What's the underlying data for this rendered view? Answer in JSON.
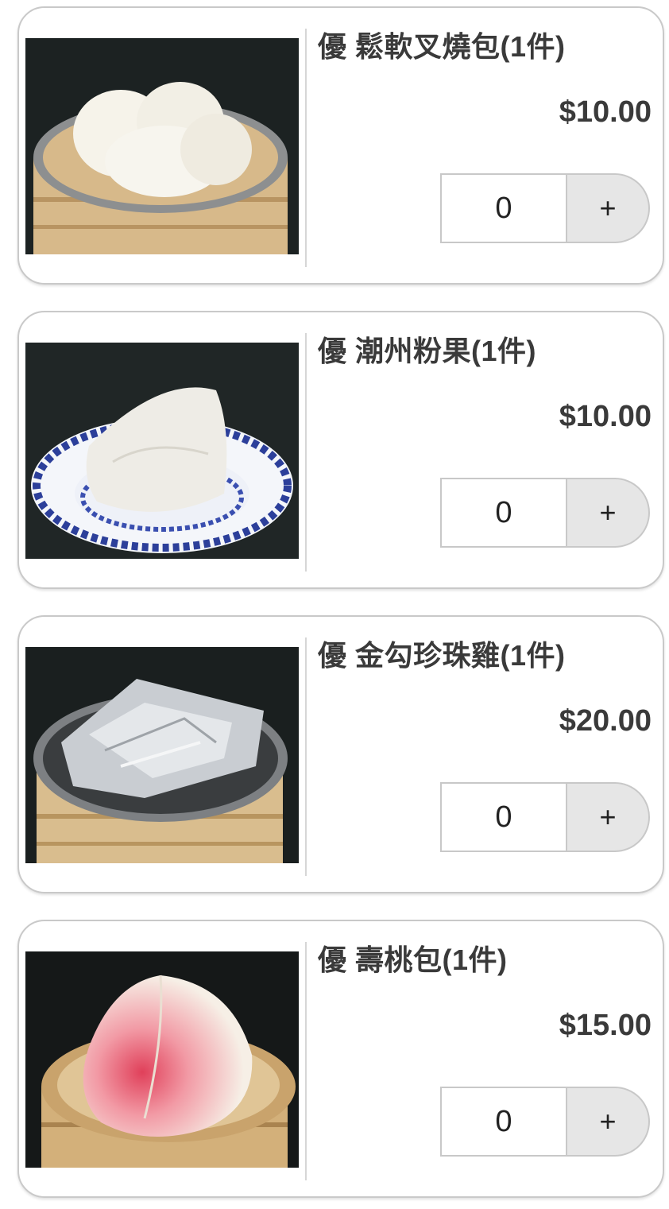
{
  "items": [
    {
      "name": "優 鬆軟叉燒包(1件)",
      "price": "$10.00",
      "quantity": "0",
      "plus_label": "+",
      "image": "char-siu-bao-steamer"
    },
    {
      "name": "優 潮州粉果(1件)",
      "price": "$10.00",
      "quantity": "0",
      "plus_label": "+",
      "image": "chiu-chow-dumpling-plate"
    },
    {
      "name": "優 金勾珍珠雞(1件)",
      "price": "$20.00",
      "quantity": "0",
      "plus_label": "+",
      "image": "pearl-chicken-foil-steamer"
    },
    {
      "name": "優 壽桃包(1件)",
      "price": "$15.00",
      "quantity": "0",
      "plus_label": "+",
      "image": "longevity-peach-bun-steamer"
    }
  ]
}
